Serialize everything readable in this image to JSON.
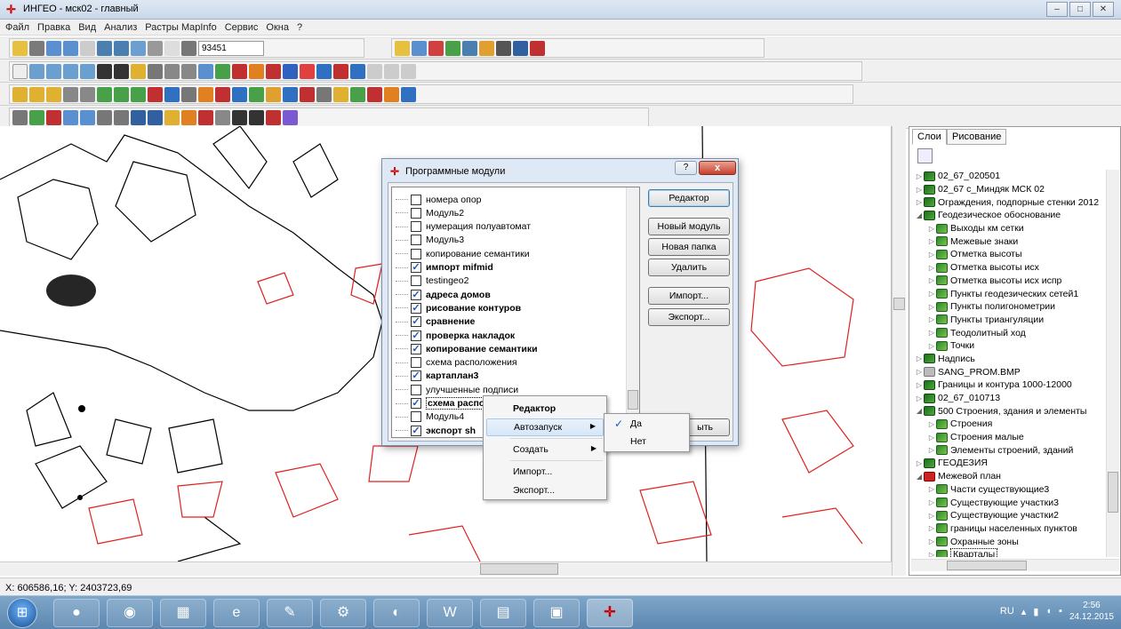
{
  "window": {
    "title": "ИНГЕО - мск02 - главный",
    "app_icon": "ingeo-app-icon",
    "min_label": "–",
    "max_label": "□",
    "close_label": "✕"
  },
  "menu": [
    "Файл",
    "Правка",
    "Вид",
    "Анализ",
    "Растры MapInfo",
    "Сервис",
    "Окна",
    "?"
  ],
  "toolbar": {
    "zoom_value": "93451"
  },
  "status": {
    "coords": "X: 606586,16; Y: 2403723,69"
  },
  "layers_panel": {
    "tabs": [
      "Слои",
      "Рисование"
    ],
    "items": [
      {
        "label": "02_67_020501",
        "type": "group",
        "level": 0
      },
      {
        "label": "02_67 с_Миндяк МСК 02",
        "type": "group",
        "level": 0
      },
      {
        "label": "Ограждения, подпорные стенки 2012",
        "type": "group",
        "level": 0
      },
      {
        "label": "Геодезическое обоснование",
        "type": "group",
        "level": 0,
        "expanded": true
      },
      {
        "label": "Выходы км сетки",
        "type": "layer",
        "level": 1
      },
      {
        "label": "Межевые знаки",
        "type": "layer",
        "level": 1
      },
      {
        "label": "Отметка высоты",
        "type": "layer",
        "level": 1
      },
      {
        "label": "Отметка высоты исх",
        "type": "layer",
        "level": 1
      },
      {
        "label": "Отметка высоты исх испр",
        "type": "layer",
        "level": 1
      },
      {
        "label": "Пункты геодезических сетей1",
        "type": "layer",
        "level": 1
      },
      {
        "label": "Пункты полигонометрии",
        "type": "layer",
        "level": 1
      },
      {
        "label": "Пункты триангуляции",
        "type": "layer",
        "level": 1
      },
      {
        "label": "Теодолитный ход",
        "type": "layer",
        "level": 1
      },
      {
        "label": "Точки",
        "type": "layer",
        "level": 1
      },
      {
        "label": "Надпись",
        "type": "group",
        "level": 0
      },
      {
        "label": "SANG_PROM.BMP",
        "type": "bmp",
        "level": 0
      },
      {
        "label": "Границы и контура 1000-12000",
        "type": "group",
        "level": 0
      },
      {
        "label": "02_67_010713",
        "type": "group",
        "level": 0
      },
      {
        "label": "500 Строения, здания и элементы",
        "type": "group",
        "level": 0,
        "expanded": true
      },
      {
        "label": "Строения",
        "type": "layer",
        "level": 1
      },
      {
        "label": "Строения малые",
        "type": "layer",
        "level": 1
      },
      {
        "label": "Элементы строений, зданий",
        "type": "layer",
        "level": 1
      },
      {
        "label": "ГЕОДЕЗИЯ",
        "type": "group",
        "level": 0
      },
      {
        "label": "Межевой план",
        "type": "red",
        "level": 0,
        "expanded": true
      },
      {
        "label": "Части существующие3",
        "type": "layer",
        "level": 1
      },
      {
        "label": "Существующие участки3",
        "type": "layer",
        "level": 1
      },
      {
        "label": "Существующие участки2",
        "type": "layer",
        "level": 1
      },
      {
        "label": "границы населенных пунктов",
        "type": "layer",
        "level": 1
      },
      {
        "label": "Охранные зоны",
        "type": "layer",
        "level": 1
      },
      {
        "label": "Кварталы",
        "type": "layer",
        "level": 1,
        "selected": true
      }
    ]
  },
  "dialog": {
    "title": "Программные модули",
    "help_label": "?",
    "close_label": "x",
    "modules": [
      {
        "label": "номера опор",
        "checked": false,
        "bold": false
      },
      {
        "label": "Модуль2",
        "checked": false,
        "bold": false
      },
      {
        "label": "нумерация полуавтомат",
        "checked": false,
        "bold": false
      },
      {
        "label": "Модуль3",
        "checked": false,
        "bold": false
      },
      {
        "label": "копирование семантики",
        "checked": false,
        "bold": false
      },
      {
        "label": "импорт mifmid",
        "checked": true,
        "bold": true
      },
      {
        "label": "testingeo2",
        "checked": false,
        "bold": false
      },
      {
        "label": "адреса домов",
        "checked": true,
        "bold": true
      },
      {
        "label": "рисование контуров",
        "checked": true,
        "bold": true
      },
      {
        "label": "сравнение",
        "checked": true,
        "bold": true
      },
      {
        "label": "проверка накладок",
        "checked": true,
        "bold": true
      },
      {
        "label": "копирование семантики",
        "checked": true,
        "bold": true
      },
      {
        "label": "схема расположения",
        "checked": false,
        "bold": false
      },
      {
        "label": "картаплан3",
        "checked": true,
        "bold": true
      },
      {
        "label": "улучшенные подписи",
        "checked": false,
        "bold": false
      },
      {
        "label": "схема расположения2",
        "checked": true,
        "bold": true,
        "selected": true
      },
      {
        "label": "Модуль4",
        "checked": false,
        "bold": false
      },
      {
        "label": "экспорт sh",
        "checked": true,
        "bold": true
      }
    ],
    "buttons": {
      "editor": "Редактор",
      "new_module": "Новый модуль",
      "new_folder": "Новая папка",
      "delete": "Удалить",
      "import": "Импорт...",
      "export": "Экспорт...",
      "close": "ыть"
    }
  },
  "context_menu": {
    "items": [
      {
        "label": "Редактор",
        "bold": true
      },
      {
        "label": "Автозапуск",
        "submenu": true,
        "highlighted": true
      },
      {
        "label": "Создать",
        "submenu": true
      },
      {
        "label": "Импорт...",
        "submenu": false
      },
      {
        "label": "Экспорт...",
        "submenu": false
      }
    ],
    "submenu": [
      {
        "label": "Да",
        "checked": true
      },
      {
        "label": "Нет",
        "checked": false
      }
    ]
  },
  "taskbar": {
    "apps": [
      "start-orb",
      "chrome",
      "firefox",
      "calculator",
      "internet-explorer",
      "notepad",
      "tools",
      "app-blue-circle",
      "word",
      "explorer",
      "mapinfo",
      "ingeo"
    ],
    "tray_lang": "RU",
    "clock_time": "2:56",
    "clock_date": "24.12.2015"
  },
  "colors": {
    "map_line_red": "#e02020",
    "map_line_black": "#000000",
    "title_bar": "#c9d8ea",
    "dialog_frame": "#dfe9f5"
  }
}
